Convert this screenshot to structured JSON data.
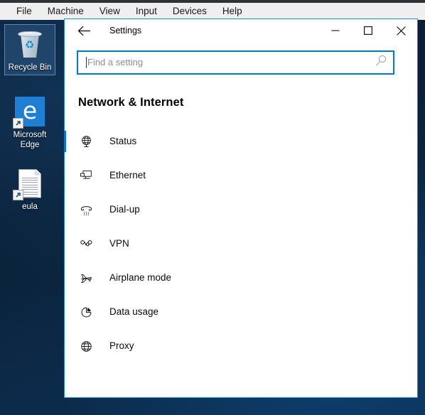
{
  "vbox": {
    "menu_items": [
      {
        "label": "File",
        "name": "vbox-menu-file"
      },
      {
        "label": "Machine",
        "name": "vbox-menu-machine"
      },
      {
        "label": "View",
        "name": "vbox-menu-view"
      },
      {
        "label": "Input",
        "name": "vbox-menu-input"
      },
      {
        "label": "Devices",
        "name": "vbox-menu-devices"
      },
      {
        "label": "Help",
        "name": "vbox-menu-help"
      }
    ]
  },
  "desktop": {
    "icons": [
      {
        "label": "Recycle Bin",
        "icon": "recycle-bin-icon",
        "selected": true,
        "shortcut": false
      },
      {
        "label": "Microsoft Edge",
        "icon": "microsoft-edge-icon",
        "selected": false,
        "shortcut": true
      },
      {
        "label": "eula",
        "icon": "text-document-icon",
        "selected": false,
        "shortcut": true
      }
    ]
  },
  "settings_window": {
    "title": "Settings",
    "back_icon": "back-arrow-icon",
    "controls": {
      "minimize": "minimize-icon",
      "maximize": "maximize-icon",
      "close": "close-icon"
    },
    "search": {
      "placeholder": "Find a setting",
      "value": "",
      "icon": "search-icon"
    },
    "heading": "Network & Internet",
    "nav_items": [
      {
        "label": "Status",
        "icon": "globe-status-icon",
        "selected": true
      },
      {
        "label": "Ethernet",
        "icon": "ethernet-icon",
        "selected": false
      },
      {
        "label": "Dial-up",
        "icon": "dial-up-icon",
        "selected": false
      },
      {
        "label": "VPN",
        "icon": "vpn-icon",
        "selected": false
      },
      {
        "label": "Airplane mode",
        "icon": "airplane-icon",
        "selected": false
      },
      {
        "label": "Data usage",
        "icon": "pie-chart-icon",
        "selected": false
      },
      {
        "label": "Proxy",
        "icon": "globe-icon",
        "selected": false
      }
    ]
  },
  "colors": {
    "accent": "#0078d7",
    "window_border": "#1e90d8",
    "menubar_bg": "#efefef",
    "edge_blue": "#1e7fd4"
  }
}
